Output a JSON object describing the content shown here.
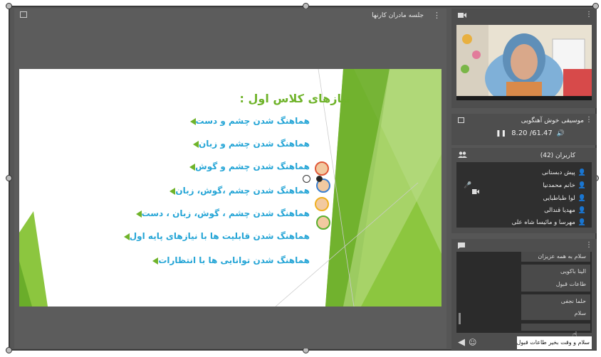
{
  "presentation": {
    "title": "جلسه مادران کارنها",
    "menu_icon": "⋮",
    "fullscreen_icon": "fullscreen-icon",
    "slide": {
      "title": "نیازهای کلاس اول :",
      "bullets": [
        "هماهنگ شدن چشم و دست",
        "هماهنگ شدن چشم و زبان",
        "هماهنگ شدن چشم و گوش",
        "هماهنگ شدن چشم ،گوش، زبان",
        "هماهنگ شدن چشم ، گوش، زبان ، دست",
        "هماهنگ شدن قابلیت ها با نیازهای پایه اول",
        "هماهنگ شدن توانایی ها با انتظارات"
      ],
      "accent_green": "#6fb32a",
      "accent_blue": "#25a5d6"
    }
  },
  "video_panel": {
    "icon": "camera-icon",
    "menu_icon": "⋮"
  },
  "media": {
    "title": "موسیقی خوش آهنگویی",
    "pause_icon": "❚❚",
    "time": "8.20 /61.47",
    "volume_icon": "🔊"
  },
  "users": {
    "title": "کاربران (42)",
    "items": [
      {
        "name": "پیش دبستانی",
        "color": "#2d8de0"
      },
      {
        "name": "خانم محمدنیا",
        "color": "#3cc13c"
      },
      {
        "name": "لوا طباطبایی",
        "color": "#e6d83a"
      },
      {
        "name": "مهدیا قندالی",
        "color": "#e6d83a"
      },
      {
        "name": "مهرسا و مائیسا شاه علی",
        "color": "#e6d83a"
      }
    ]
  },
  "chat": {
    "messages": [
      {
        "text": "سلام به همه عزیزان"
      },
      {
        "name": "الینا باکویی",
        "text": "طاعات قبول"
      },
      {
        "name": "حلما نجفی",
        "text": "سلام"
      }
    ],
    "input_value": "سلام و وقت بخیر طاعات قبول",
    "send_icon": "◀",
    "emoji_icon": "☺"
  }
}
